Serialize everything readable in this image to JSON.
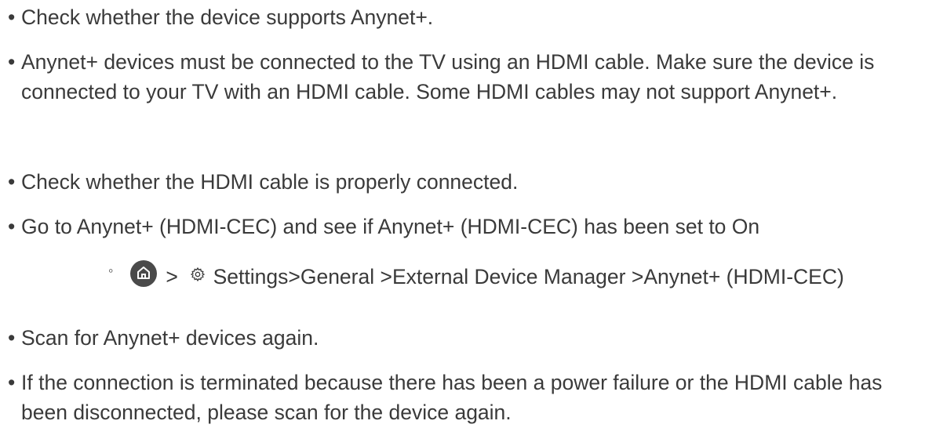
{
  "items": [
    {
      "bullet": "•",
      "text": "Check whether the device supports Anynet+."
    },
    {
      "bullet": "•",
      "text": "Anynet+ devices must be connected to the TV using an HDMI cable. Make sure the device is connected to your TV with an HDMI cable. Some HDMI cables may not support Anynet+."
    },
    {
      "bullet": "•",
      "text": "Check whether the HDMI cable is properly connected."
    },
    {
      "bullet": "•",
      "text": "Go to Anynet+ (HDMI-CEC) and see if Anynet+ (HDMI-CEC) has been set to On"
    },
    {
      "bullet": "•",
      "text": "Scan for Anynet+ devices again."
    },
    {
      "bullet": "•",
      "text": "If the connection is terminated because there has been a power failure or the HDMI cable has been disconnected, please scan for the device again."
    }
  ],
  "path": {
    "bullet": "◦",
    "home_icon": "home-icon",
    "separator": ">",
    "gear_icon": "gear-icon",
    "text": "Settings>General >External Device Manager >Anynet+ (HDMI-CEC)"
  },
  "colors": {
    "text": "#3a3a3a",
    "icon": "#4a4a4a"
  }
}
